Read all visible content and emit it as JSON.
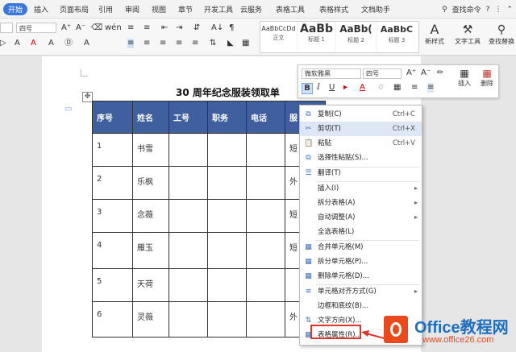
{
  "tabs": [
    "开始",
    "插入",
    "页面布局",
    "引用",
    "审阅",
    "视图",
    "章节",
    "开发工具",
    "云服务",
    "表格工具",
    "表格样式",
    "文档助手"
  ],
  "search_label": "查找命令",
  "ribbon": {
    "font_size": "四号",
    "styles": [
      {
        "sample": "AaBbCcDd",
        "name": "正文"
      },
      {
        "sample": "AaBb",
        "name": "标题 1"
      },
      {
        "sample": "AaBb(",
        "name": "标题 2"
      },
      {
        "sample": "AaBbC",
        "name": "标题 3"
      }
    ],
    "new_style": "新样式",
    "text_tools": "文字工具",
    "find_replace": "查找替换"
  },
  "document": {
    "title": "30 周年纪念服装领取单",
    "headers": [
      "序号",
      "姓名",
      "工号",
      "职务",
      "电话",
      "服"
    ],
    "rows": [
      [
        "1",
        "书雪",
        "",
        "",
        "",
        "短"
      ],
      [
        "2",
        "乐枫",
        "",
        "",
        "",
        "外"
      ],
      [
        "3",
        "念薇",
        "",
        "",
        "",
        "短"
      ],
      [
        "4",
        "雁玉",
        "",
        "",
        "",
        "短"
      ],
      [
        "5",
        "天荷",
        "",
        "",
        "",
        ""
      ],
      [
        "6",
        "灵薇",
        "",
        "",
        "",
        "外"
      ]
    ]
  },
  "mini_toolbar": {
    "font_name": "微软雅黑",
    "font_size": "四号",
    "insert_label": "插入",
    "delete_label": "删除"
  },
  "context_menu": {
    "items": [
      {
        "label": "复制(C)",
        "shortcut": "Ctrl+C",
        "icon": "copy-icon"
      },
      {
        "label": "剪切(T)",
        "shortcut": "Ctrl+X",
        "icon": "scissors-icon"
      },
      {
        "label": "粘贴",
        "shortcut": "Ctrl+V",
        "icon": "paste-icon"
      },
      {
        "label": "选择性粘贴(S)...",
        "shortcut": "",
        "icon": "paste-special-icon"
      },
      {
        "label": "翻译(T)",
        "shortcut": "",
        "icon": "translate-icon"
      },
      {
        "label": "插入(I)",
        "shortcut": "",
        "icon": "",
        "submenu": true
      },
      {
        "label": "拆分表格(A)",
        "shortcut": "",
        "icon": "",
        "submenu": true
      },
      {
        "label": "自动调整(A)",
        "shortcut": "",
        "icon": "",
        "submenu": true
      },
      {
        "label": "全选表格(L)",
        "shortcut": "",
        "icon": ""
      },
      {
        "label": "合并单元格(M)",
        "shortcut": "",
        "icon": "merge-cells-icon"
      },
      {
        "label": "拆分单元格(P)...",
        "shortcut": "",
        "icon": "split-cells-icon"
      },
      {
        "label": "删除单元格(D)...",
        "shortcut": "",
        "icon": "delete-cells-icon"
      },
      {
        "label": "单元格对齐方式(G)",
        "shortcut": "",
        "icon": "cell-align-icon",
        "submenu": true
      },
      {
        "label": "边框和底纹(B)...",
        "shortcut": "",
        "icon": ""
      },
      {
        "label": "文字方向(X)...",
        "shortcut": "",
        "icon": "text-direction-icon"
      },
      {
        "label": "表格属性(R)...",
        "shortcut": "",
        "icon": "table-properties-icon"
      }
    ]
  },
  "watermark": {
    "brand": "Office教程网",
    "url": "www.office26.com"
  }
}
